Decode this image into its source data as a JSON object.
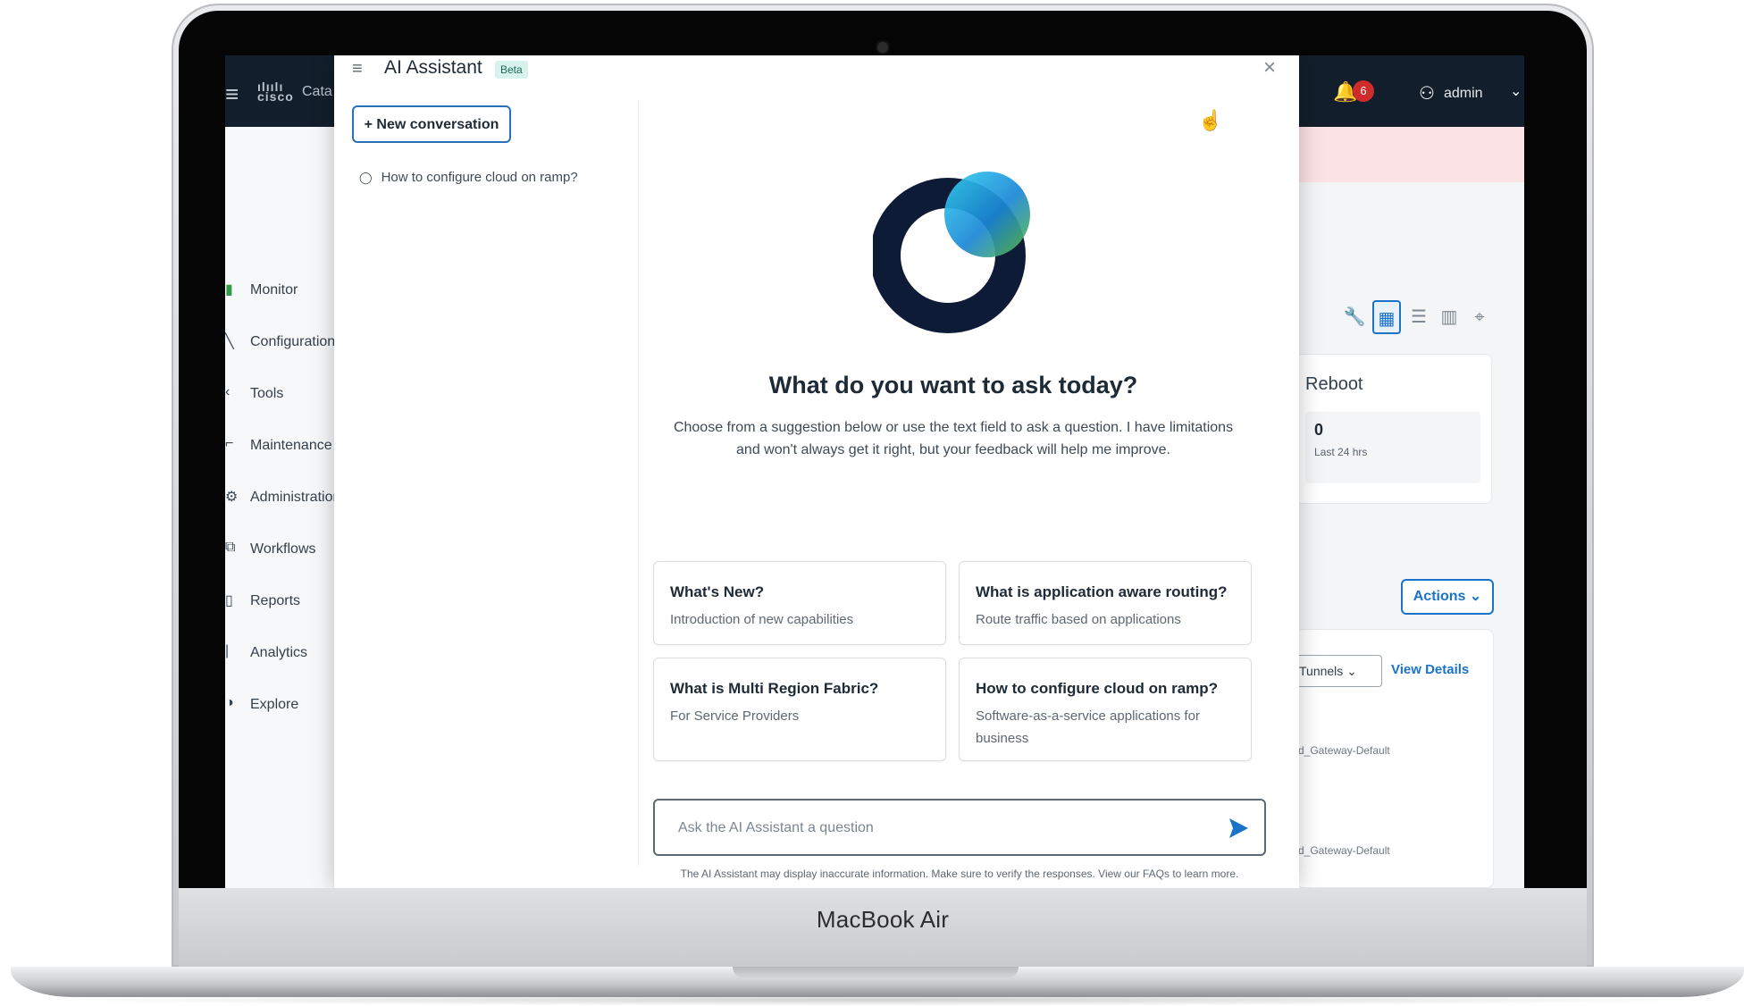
{
  "device": {
    "brand_label": "MacBook Air"
  },
  "app": {
    "topbar": {
      "logo_text": "cisco",
      "app_name": "Cata",
      "notification_count": "6",
      "username": "admin"
    },
    "sidebar": {
      "items": [
        {
          "label": "Monitor",
          "icon": "monitor-icon"
        },
        {
          "label": "Configuration",
          "icon": "configuration-icon"
        },
        {
          "label": "Tools",
          "icon": "tools-icon"
        },
        {
          "label": "Maintenance",
          "icon": "maintenance-icon"
        },
        {
          "label": "Administration",
          "icon": "administration-icon"
        },
        {
          "label": "Workflows",
          "icon": "workflows-icon"
        },
        {
          "label": "Reports",
          "icon": "reports-icon"
        },
        {
          "label": "Analytics",
          "icon": "analytics-icon"
        },
        {
          "label": "Explore",
          "icon": "explore-icon"
        }
      ]
    },
    "right_panel": {
      "reboot_title": "Reboot",
      "reboot_value": "0",
      "reboot_sub": "Last 24 hrs",
      "actions_label": "Actions",
      "tunnels_label": "Tunnels",
      "view_details_label": "View Details",
      "gateway_rows": [
        "d_Gateway-Default",
        "d_Gateway-Default"
      ]
    }
  },
  "assistant": {
    "title": "AI Assistant",
    "beta_badge": "Beta",
    "new_conversation_label": "+ New conversation",
    "history": [
      "How to configure cloud on ramp?"
    ],
    "heading": "What do you want to ask today?",
    "subtext": "Choose from a suggestion below or use the text field to ask a question. I have limitations and won't always get it right, but your feedback will help me improve.",
    "suggestions": [
      {
        "title": "What's New?",
        "subtitle": "Introduction of new capabilities"
      },
      {
        "title": "What is application aware routing?",
        "subtitle": "Route traffic based on applications"
      },
      {
        "title": "What is Multi Region Fabric?",
        "subtitle": "For Service Providers"
      },
      {
        "title": "How to configure cloud on ramp?",
        "subtitle": "Software-as-a-service applications for business"
      }
    ],
    "input_placeholder": "Ask the AI Assistant a question",
    "disclaimer": "The AI Assistant may display inaccurate information. Make sure to verify the responses. View our FAQs to learn more."
  },
  "colors": {
    "topbar": "#121e2b",
    "accent": "#1a73c9",
    "logo_navy": "#0d1b36",
    "logo_cyan": "#1fb5e8",
    "logo_green": "#5fbf3a",
    "alert_strip": "#fbe2e5"
  }
}
